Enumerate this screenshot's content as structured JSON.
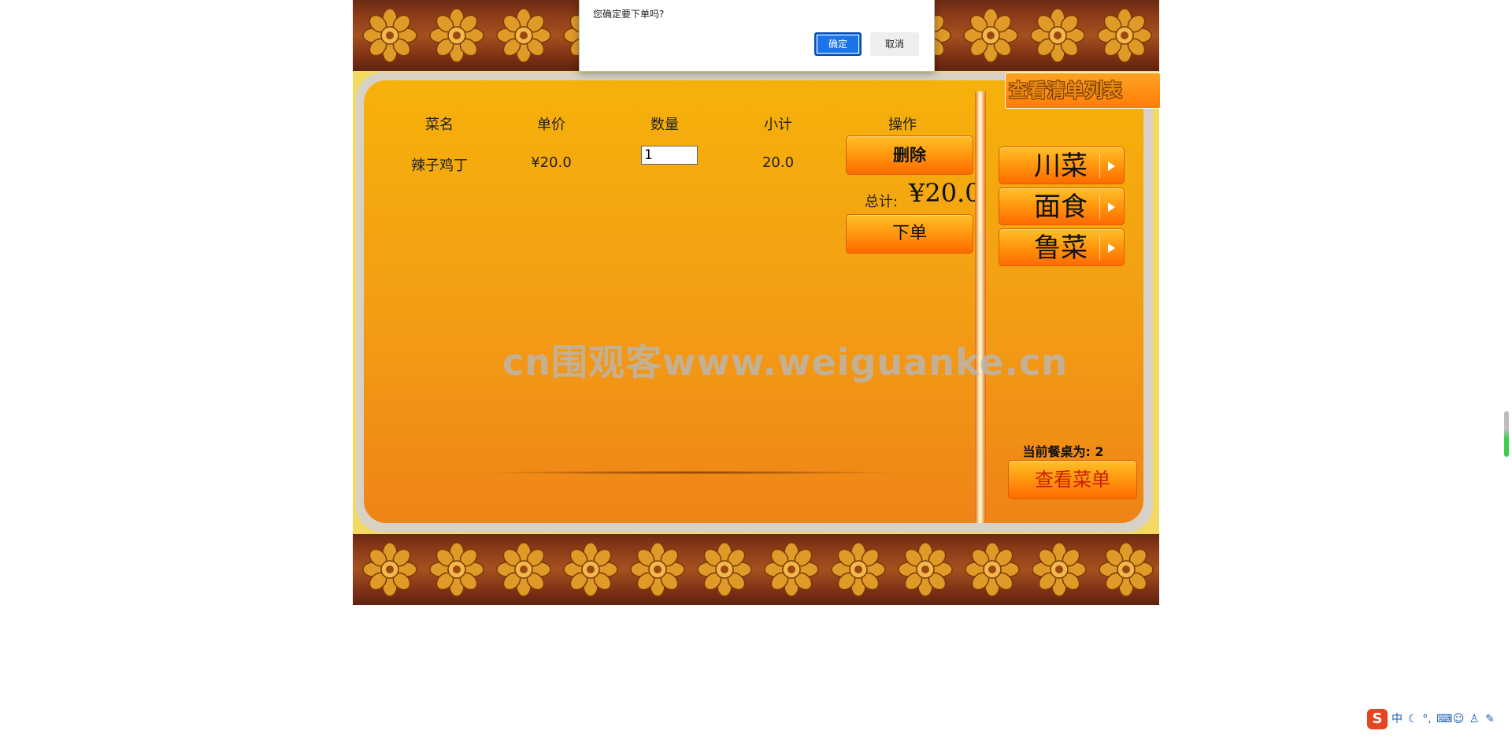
{
  "dialog": {
    "message": "您确定要下单吗?",
    "ok_label": "确定",
    "cancel_label": "取消"
  },
  "cart": {
    "headers": [
      "菜名",
      "单价",
      "数量",
      "小计",
      "操作"
    ],
    "rows": [
      {
        "name": "辣子鸡丁",
        "price": "¥20.0",
        "quantity": "1",
        "subtotal": "20.0",
        "delete_label": "删除"
      }
    ],
    "total_label": "总计:",
    "total_value": "¥20.0",
    "order_label": "下单"
  },
  "sidebar": {
    "view_list_label": "查看清单列表",
    "categories": [
      "川菜",
      "面食",
      "鲁菜"
    ],
    "table_label": "当前餐桌为: 2",
    "view_menu_label": "查看菜单"
  },
  "watermark": "cn围观客www.weiguanke.cn",
  "ime": {
    "logo": "S",
    "mode": "中"
  },
  "colors": {
    "accent_orange": "#ff9a10",
    "panel_top": "#f6b10a",
    "panel_bottom": "#ef8417",
    "border_wood": "#8a3a18",
    "dialog_ok": "#1a73e8"
  }
}
